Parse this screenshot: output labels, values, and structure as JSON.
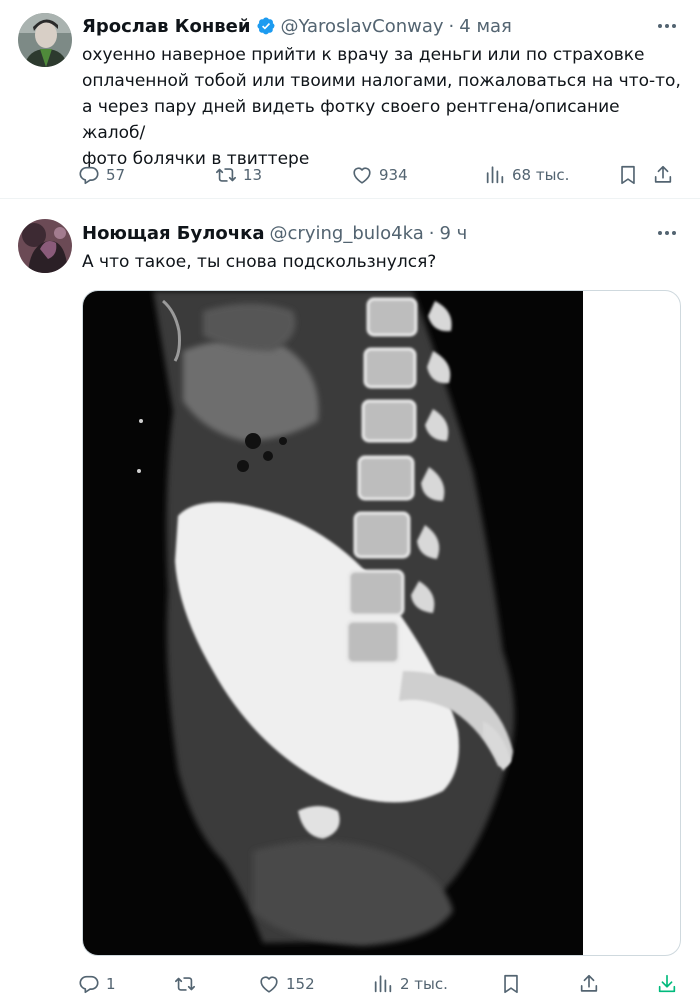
{
  "tweets": [
    {
      "author": {
        "display_name": "Ярослав Конвей",
        "handle": "@YaroslavConway",
        "verified": true
      },
      "time": "4 мая",
      "text": "охуенно наверное прийти к врачу за деньги или по страховке\nоплаченной тобой или твоими налогами, пожаловаться на что-то,\nа через пару дней видеть фотку своего рентгена/описание жалоб/\nфото болячки в твиттере",
      "actions": {
        "replies": "57",
        "retweets": "13",
        "likes": "934",
        "views": "68 тыс."
      }
    },
    {
      "author": {
        "display_name": "Ноющая Булочка",
        "handle": "@crying_bulo4ka",
        "verified": false
      },
      "time": "9 ч",
      "text": "А что такое, ты снова подскользнулся?",
      "media": {
        "type": "image",
        "subject": "ct-scan-sagittal"
      },
      "actions": {
        "replies": "1",
        "retweets": "",
        "likes": "152",
        "views": "2 тыс."
      }
    }
  ],
  "separator": "·",
  "colors": {
    "text": "#0f1419",
    "secondary": "#536471",
    "verified_badge": "#1d9bf0",
    "download_icon": "#00ba7c",
    "border": "#cfd9de"
  },
  "icons": [
    "reply-icon",
    "retweet-icon",
    "like-icon",
    "views-icon",
    "bookmark-icon",
    "share-icon",
    "download-icon",
    "more-icon",
    "verified-badge-icon"
  ]
}
